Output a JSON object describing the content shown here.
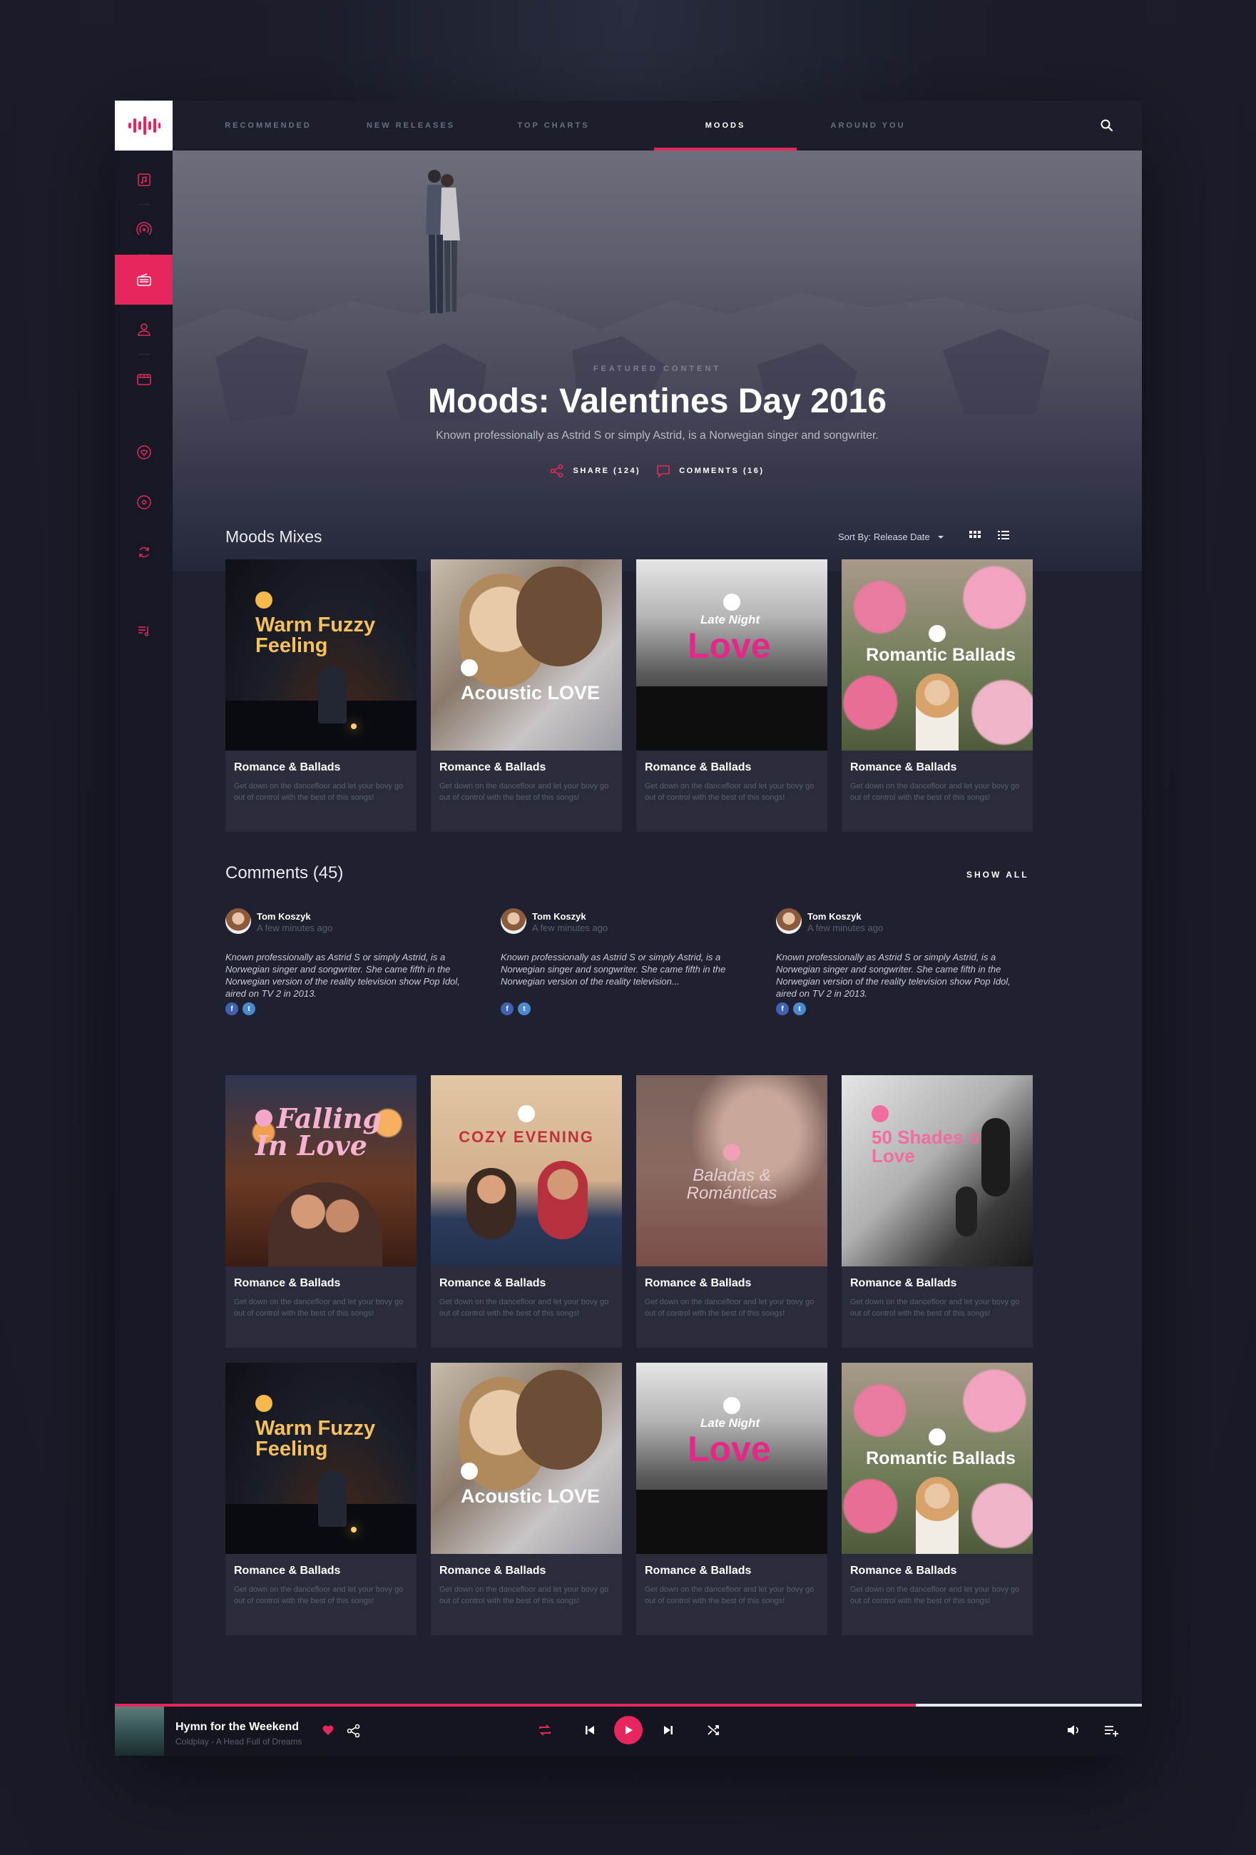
{
  "nav": {
    "tabs": [
      {
        "label": "RECOMMENDED"
      },
      {
        "label": "NEW RELEASES"
      },
      {
        "label": "TOP CHARTS"
      },
      {
        "label": "MOODS"
      },
      {
        "label": "AROUND YOU"
      }
    ],
    "active_tab": "MOODS"
  },
  "sidebar": {
    "icons": [
      "music-note-icon",
      "radio-signal-icon",
      "radio-icon",
      "user-icon",
      "video-icon",
      "heart-icon",
      "disc-icon",
      "loop-icon",
      "playlist-icon"
    ],
    "active_icon": "radio-icon"
  },
  "hero": {
    "eyebrow": "FEATURED CONTENT",
    "title": "Moods: Valentines Day 2016",
    "subtitle": "Known professionally as Astrid S or simply Astrid, is a Norwegian singer and songwriter.",
    "share_label": "SHARE (124)",
    "comments_label": "COMMENTS (16)"
  },
  "mixes": {
    "title": "Moods Mixes",
    "sort_label": "Sort By: Release Date"
  },
  "cards_row1": [
    {
      "art_text": "Warm Fuzzy Feeling",
      "title": "Romance & Ballads",
      "desc": "Get down on the dancefloor and let your bovy go out of control with the best of this songs!"
    },
    {
      "art_text": "Acoustic LOVE",
      "title": "Romance & Ballads",
      "desc": "Get down on the dancefloor and let your bovy go out of control with the best of this songs!"
    },
    {
      "art_text": "Love",
      "art_pre": "Late Night",
      "title": "Romance & Ballads",
      "desc": "Get down on the dancefloor and let your bovy go out of control with the best of this songs!"
    },
    {
      "art_text": "Romantic Ballads",
      "title": "Romance & Ballads",
      "desc": "Get down on the dancefloor and let your bovy go out of control with the best of this songs!"
    }
  ],
  "comments": {
    "title": "Comments (45)",
    "show_all": "SHOW ALL",
    "items": [
      {
        "name": "Tom Koszyk",
        "time": "A few minutes ago",
        "text": "Known professionally as Astrid S or simply Astrid, is a Norwegian singer and songwriter. She came fifth in the Norwegian version of the reality television show Pop Idol, aired on TV 2 in 2013."
      },
      {
        "name": "Tom Koszyk",
        "time": "A few minutes ago",
        "text": "Known professionally as Astrid S or simply Astrid, is a Norwegian singer and songwriter. She came fifth in the Norwegian version of the reality television..."
      },
      {
        "name": "Tom Koszyk",
        "time": "A few minutes ago",
        "text": "Known professionally as Astrid S or simply Astrid, is a Norwegian singer and songwriter. She came fifth in the Norwegian version of the reality television show Pop Idol, aired on TV 2 in 2013."
      }
    ]
  },
  "cards_row2": [
    {
      "art_text": "Falling In Love",
      "title": "Romance & Ballads",
      "desc": "Get down on the dancefloor and let your bovy go out of control with the best of this songs!"
    },
    {
      "art_text": "COZY EVENING",
      "title": "Romance & Ballads",
      "desc": "Get down on the dancefloor and let your bovy go out of control with the best of this songs!"
    },
    {
      "art_text": "Baladas & Románticas",
      "title": "Romance & Ballads",
      "desc": "Get down on the dancefloor and let your bovy go out of control with the best of this songs!"
    },
    {
      "art_text": "50 Shades of Love",
      "title": "Romance & Ballads",
      "desc": "Get down on the dancefloor and let your bovy go out of control with the best of this songs!"
    }
  ],
  "cards_row3": [
    {
      "art_text": "Warm Fuzzy Feeling",
      "title": "Romance & Ballads",
      "desc": "Get down on the dancefloor and let your bovy go out of control with the best of this songs!"
    },
    {
      "art_text": "Acoustic LOVE",
      "title": "Romance & Ballads",
      "desc": "Get down on the dancefloor and let your bovy go out of control with the best of this songs!"
    },
    {
      "art_text": "Love",
      "art_pre": "Late Night",
      "title": "Romance & Ballads",
      "desc": "Get down on the dancefloor and let your bovy go out of control with the best of this songs!"
    },
    {
      "art_text": "Romantic Ballads",
      "title": "Romance & Ballads",
      "desc": "Get down on the dancefloor and let your bovy go out of control with the best of this songs!"
    }
  ],
  "player": {
    "track": "Hymn for the Weekend",
    "artist": "Coldplay - A Head Full of Dreams",
    "progress": 0.78
  },
  "colors": {
    "accent": "#e8265e",
    "background": "#1f2130",
    "sidebar": "#171826"
  }
}
